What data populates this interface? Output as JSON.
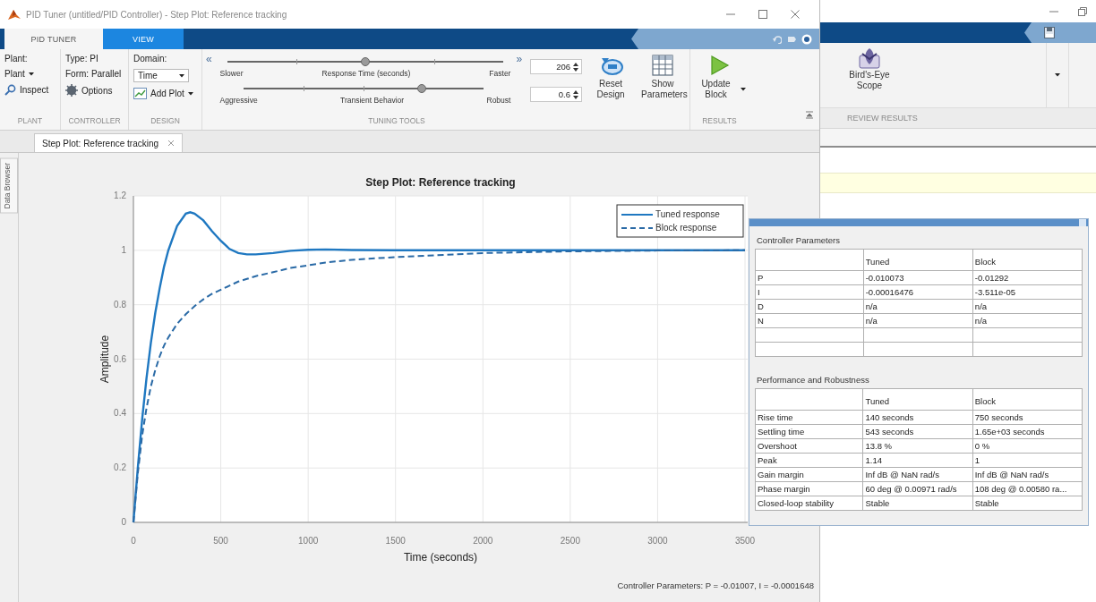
{
  "main_window": {
    "title": "PID Tuner (untitled/PID Controller) - Step Plot: Reference tracking"
  },
  "ribbon_tabs": [
    {
      "label": "PID TUNER",
      "selected": true
    },
    {
      "label": "VIEW",
      "selected": false
    }
  ],
  "ribbon": {
    "plant": {
      "heading": "Plant:",
      "plant_menu": "Plant",
      "inspect": "Inspect",
      "label": "PLANT"
    },
    "controller": {
      "type": "Type: PI",
      "form": "Form: Parallel",
      "options": "Options",
      "label": "CONTROLLER"
    },
    "design": {
      "heading": "Domain:",
      "domain": "Time",
      "add_plot": "Add Plot",
      "label": "DESIGN"
    },
    "tuning_tools": {
      "collapse": "«",
      "expand": "»",
      "label": "TUNING TOOLS",
      "sliders": [
        {
          "left": "Slower",
          "name": "Response Time (seconds)",
          "right": "Faster",
          "level": 0.5,
          "value": "206"
        },
        {
          "left": "Aggressive",
          "name": "Transient Behavior",
          "right": "Robust",
          "level": 0.74,
          "value": "0.6"
        }
      ]
    },
    "results": {
      "label": "RESULTS",
      "buttons": [
        {
          "label": "Reset Design",
          "kind": "reset",
          "menu": false
        },
        {
          "label": "Show Parameters",
          "kind": "table",
          "menu": false
        },
        {
          "label": "Update Block",
          "kind": "update",
          "menu": true
        }
      ]
    }
  },
  "document_tabs": [
    {
      "label": "Step Plot: Reference tracking",
      "selected": true
    }
  ],
  "side_tab": "Data Browser",
  "plot": {
    "chart_data": {
      "type": "line",
      "title": "Step Plot: Reference tracking",
      "xlabel": "Time (seconds)",
      "ylabel": "Amplitude",
      "x": [
        0,
        25,
        50,
        75,
        100,
        125,
        150,
        175,
        200,
        250,
        300,
        325,
        350,
        400,
        450,
        500,
        550,
        600,
        650,
        700,
        800,
        900,
        1000,
        1100,
        1250,
        1500,
        2000,
        2500,
        3000,
        3500
      ],
      "series": [
        {
          "name": "Tuned response",
          "color": "#1f78c1",
          "line_style": "solid",
          "values": [
            0,
            0.2,
            0.38,
            0.53,
            0.66,
            0.77,
            0.86,
            0.94,
            1.0,
            1.09,
            1.135,
            1.14,
            1.135,
            1.11,
            1.07,
            1.035,
            1.005,
            0.99,
            0.985,
            0.985,
            0.99,
            0.998,
            1.002,
            1.003,
            1.001,
            1.0,
            1.0,
            1.0,
            1.0,
            1.0
          ]
        },
        {
          "name": "Block response",
          "color": "#2a6aa6",
          "line_style": "dashed",
          "values": [
            0,
            0.18,
            0.32,
            0.42,
            0.5,
            0.56,
            0.61,
            0.65,
            0.68,
            0.73,
            0.765,
            0.78,
            0.795,
            0.82,
            0.84,
            0.855,
            0.87,
            0.885,
            0.895,
            0.905,
            0.92,
            0.935,
            0.945,
            0.955,
            0.965,
            0.975,
            0.99,
            0.996,
            0.999,
            1.0
          ]
        }
      ],
      "xlim": [
        0,
        3500
      ],
      "ylim": [
        0,
        1.2
      ],
      "xticks": [
        0,
        500,
        1000,
        1500,
        2000,
        2500,
        3000,
        3500
      ],
      "yticks": [
        0,
        0.2,
        0.4,
        0.6,
        0.8,
        1,
        {
          "value": 1.2,
          "label": "1.2"
        }
      ],
      "grid": true,
      "legend": true
    }
  },
  "status": "Controller Parameters: P = -0.01007, I = -0.0001648",
  "parameters_panel": {
    "tables": [
      {
        "title": "Controller Parameters",
        "columns": [
          "Tuned",
          "Block"
        ],
        "rows": [
          {
            "name": "P",
            "values": [
              "-0.010073",
              "-0.01292"
            ]
          },
          {
            "name": "I",
            "values": [
              "-0.00016476",
              "-3.511e-05"
            ]
          },
          {
            "name": "D",
            "values": [
              "n/a",
              "n/a"
            ]
          },
          {
            "name": "N",
            "values": [
              "n/a",
              "n/a"
            ]
          }
        ]
      },
      {
        "title": "Performance and Robustness",
        "columns": [
          "Tuned",
          "Block"
        ],
        "rows": [
          {
            "name": "Rise time",
            "values": [
              "140 seconds",
              "750 seconds"
            ]
          },
          {
            "name": "Settling time",
            "values": [
              "543 seconds",
              "1.65e+03 seconds"
            ]
          },
          {
            "name": "Overshoot",
            "values": [
              "13.8 %",
              "0 %"
            ]
          },
          {
            "name": "Peak",
            "values": [
              "1.14",
              "1"
            ]
          },
          {
            "name": "Gain margin",
            "values": [
              "Inf dB @ NaN rad/s",
              "Inf dB @ NaN rad/s"
            ]
          },
          {
            "name": "Phase margin",
            "values": [
              "60 deg @ 0.00971 rad/s",
              "108 deg @ 0.00580 ra..."
            ]
          },
          {
            "name": "Closed-loop stability",
            "values": [
              "Stable",
              "Stable"
            ]
          }
        ]
      }
    ]
  },
  "background_window": {
    "button": "Bird's-Eye Scope",
    "section": "REVIEW RESULTS"
  }
}
